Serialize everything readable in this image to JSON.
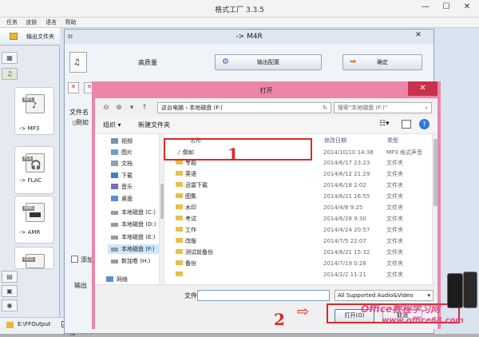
{
  "ff": {
    "title": "格式工厂 3.3.5",
    "min": "—",
    "max": "☐",
    "close": "✕",
    "menu": [
      "任务",
      "皮肤",
      "语言",
      "帮助"
    ],
    "output_folder_btn": "输出文件夹",
    "formats": [
      {
        "badge": "MP3",
        "label": "-> MP3"
      },
      {
        "badge": "FLA",
        "label": "-> FLAC"
      },
      {
        "badge": "AMR",
        "label": "-> AMR"
      },
      {
        "badge": "OGG",
        "label": ""
      }
    ],
    "footer_path": "E:\\FFOutput",
    "footer_check": "使用多线"
  },
  "m4r": {
    "title": "-> M4R",
    "quality": "高质量",
    "output_config": "输出配置",
    "ok": "确定",
    "col_filename": "文件名",
    "row1": "倒如",
    "add_check": "添加",
    "output_label": "输出",
    "close": "✕"
  },
  "open": {
    "title": "打开",
    "close": "✕",
    "address": "这台电脑 › 本地磁盘 (F:)",
    "search_placeholder": "搜索\"本地磁盘 (F:)\"",
    "organize": "组织 ▾",
    "new_folder": "新建文件夹",
    "tree": [
      {
        "label": "视频",
        "color": "#7b8fa6"
      },
      {
        "label": "图片",
        "color": "#6c9bd2"
      },
      {
        "label": "文档",
        "color": "#8aa0b8"
      },
      {
        "label": "下载",
        "color": "#3c82c8"
      },
      {
        "label": "音乐",
        "color": "#7a6fb8"
      },
      {
        "label": "桌面",
        "color": "#5a8fd0"
      },
      {
        "label": "本地磁盘 (C:)",
        "color": "#999"
      },
      {
        "label": "本地磁盘 (D:)",
        "color": "#999"
      },
      {
        "label": "本地磁盘 (E:)",
        "color": "#999"
      },
      {
        "label": "本地磁盘 (F:)",
        "color": "#999"
      },
      {
        "label": "新加卷 (H:)",
        "color": "#999"
      },
      {
        "label": "网络",
        "color": "#5a8fd0"
      }
    ],
    "columns": {
      "name": "名称",
      "date": "修改日期",
      "type": "类型"
    },
    "files": [
      {
        "name": "倒如",
        "date": "2014/10/10 14:38",
        "type": "MP3 格式声音"
      },
      {
        "name": "专题",
        "date": "2014/6/17 23:23",
        "type": "文件夹"
      },
      {
        "name": "英语",
        "date": "2014/6/12 21:29",
        "type": "文件夹"
      },
      {
        "name": "迅雷下载",
        "date": "2014/6/18 2:02",
        "type": "文件夹"
      },
      {
        "name": "图集",
        "date": "2014/6/21 16:55",
        "type": "文件夹"
      },
      {
        "name": "水印",
        "date": "2014/4/8 9:25",
        "type": "文件夹"
      },
      {
        "name": "考试",
        "date": "2014/6/28 9:30",
        "type": "文件夹"
      },
      {
        "name": "工作",
        "date": "2014/4/24 20:57",
        "type": "文件夹"
      },
      {
        "name": "改版",
        "date": "2014/7/5 22:07",
        "type": "文件夹"
      },
      {
        "name": "测试前备份",
        "date": "2014/6/21 15:32",
        "type": "文件夹"
      },
      {
        "name": "备份",
        "date": "2014/7/19 0:28",
        "type": "文件夹"
      },
      {
        "name": "",
        "date": "2014/2/2 11:21",
        "type": "文件夹"
      }
    ],
    "filename_label": "文件名(N):",
    "filename_value": "",
    "filter_value": "All Supported Audio&Video",
    "open_btn": "打开(O)",
    "cancel_btn": "取消"
  },
  "annotations": {
    "n1": "1",
    "n2": "2",
    "arrow": "⇨"
  },
  "watermark": {
    "line1": "Office教程学习网",
    "line2": "www.office68.com"
  }
}
